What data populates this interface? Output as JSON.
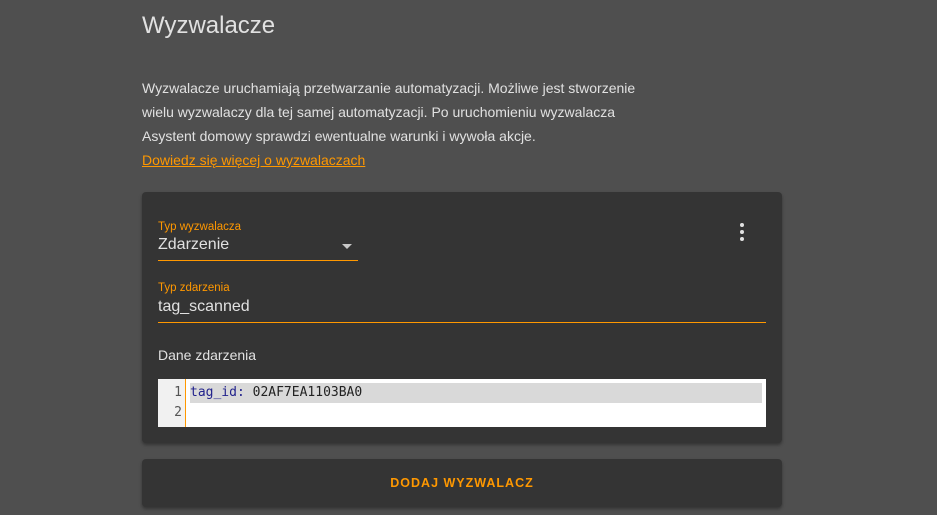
{
  "section": {
    "title": "Wyzwalacze",
    "intro_lines": [
      "Wyzwalacze uruchamiają przetwarzanie automatyzacji. Możliwe jest stworzenie",
      "wielu wyzwalaczy dla tej samej automatyzacji. Po uruchomieniu wyzwalacza",
      "Asystent domowy sprawdzi ewentualne warunki i wywoła akcje."
    ],
    "learn_more_link": "Dowiedz się więcej o wyzwalaczach"
  },
  "trigger_card": {
    "menu_icon": "more-vert-icon",
    "trigger_type": {
      "label": "Typ wyzwalacza",
      "value": "Zdarzenie"
    },
    "event_type": {
      "label": "Typ zdarzenia",
      "value": "tag_scanned"
    },
    "event_data": {
      "label": "Dane zdarzenia",
      "line_numbers": [
        "1",
        "2"
      ],
      "lines": [
        {
          "key": "tag_id:",
          "value": " 02AF7EA1103BA0"
        },
        {
          "key": "",
          "value": ""
        }
      ]
    }
  },
  "add_trigger_button": "DODAJ WYZWALACZ",
  "colors": {
    "accent": "#ff9800",
    "background": "#4f4f4f",
    "card": "#343434",
    "text": "#e1e1e1"
  }
}
